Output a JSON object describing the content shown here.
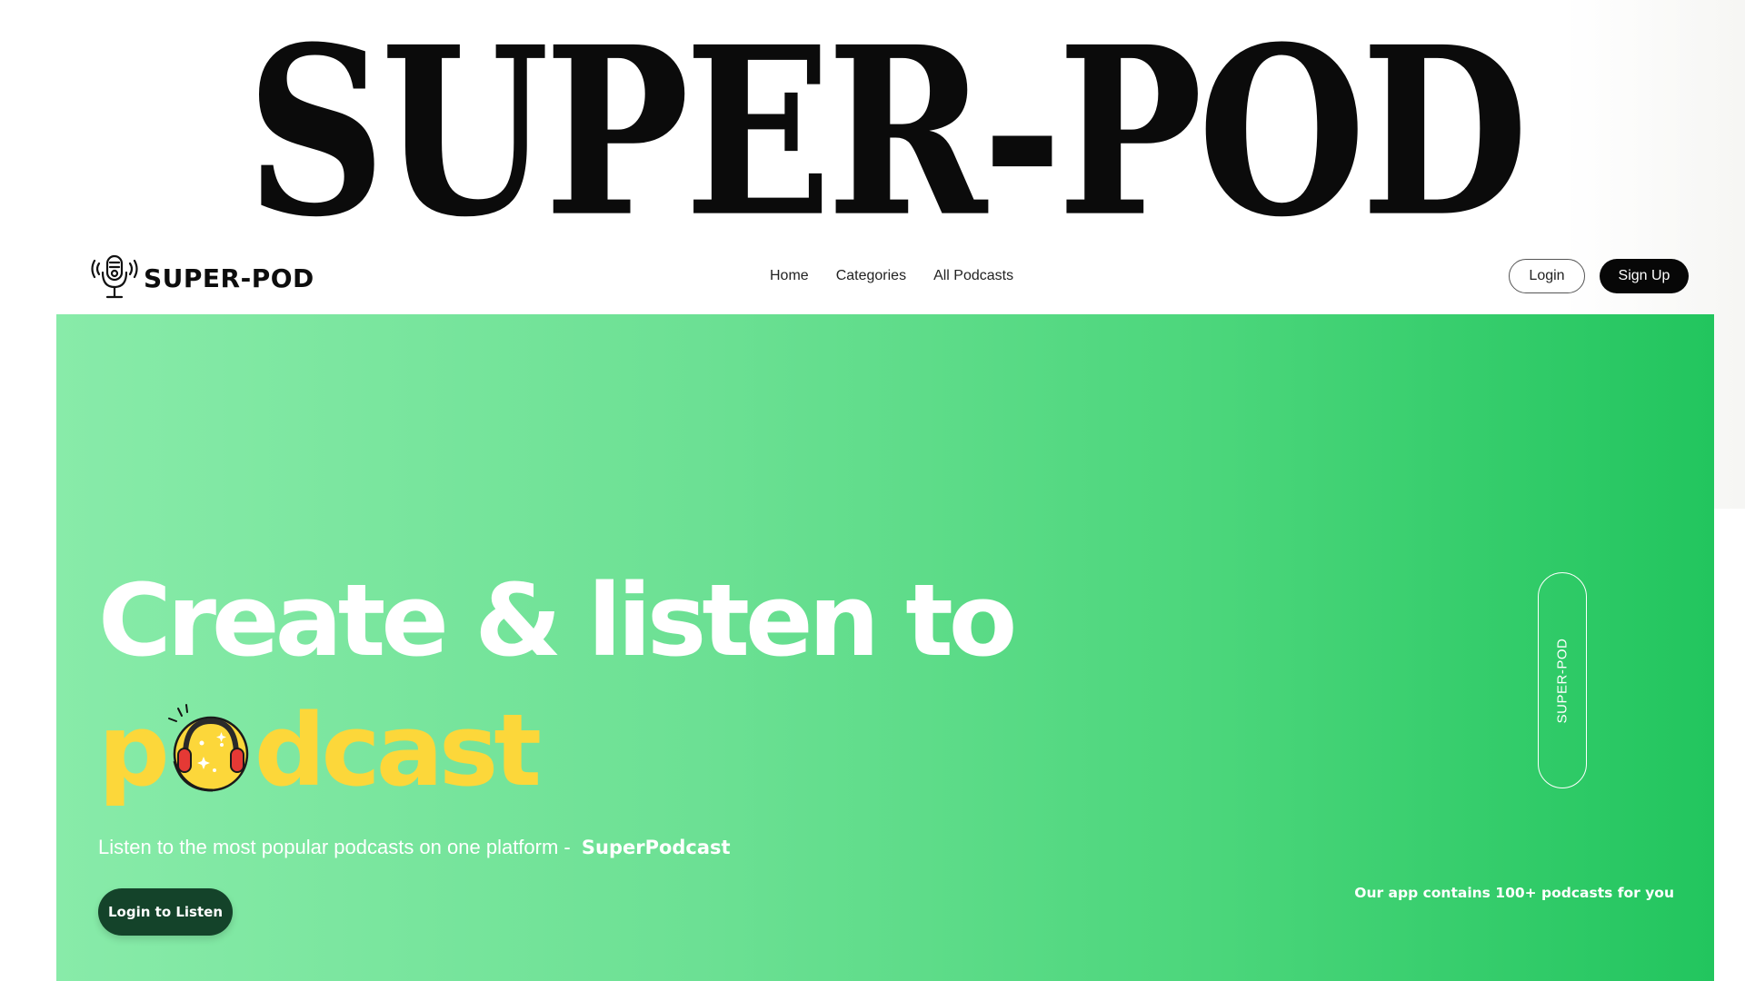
{
  "banner": {
    "title": "SUPER-POD"
  },
  "navbar": {
    "brand": "SUPER-POD",
    "brand_icon": "microphone-icon",
    "links": [
      "Home",
      "Categories",
      "All Podcasts"
    ],
    "login_label": "Login",
    "signup_label": "Sign Up"
  },
  "hero": {
    "headline_line1": "Create & listen to",
    "headline_word_start": "p",
    "headline_word_end": "dcast",
    "emoji_icon": "headphones-emoji-icon",
    "subtitle": "Listen to the most popular podcasts on one platform -",
    "subtitle_brand": "SuperPodcast",
    "cta_label": "Login to Listen",
    "side_label": "SUPER-POD",
    "note": "Our app contains 100+ podcasts for you"
  },
  "colors": {
    "hero_gradient_start": "#88eba9",
    "hero_gradient_end": "#22c55e",
    "accent_yellow": "#fcd73a",
    "cta_background": "#14432a",
    "signup_background": "#070707"
  }
}
